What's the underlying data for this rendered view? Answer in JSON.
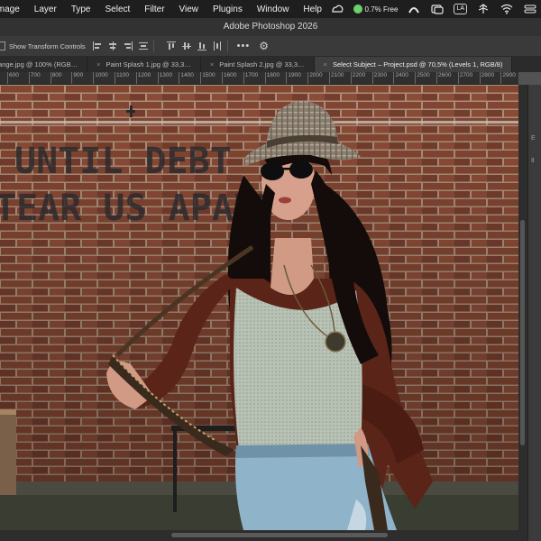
{
  "menubar": {
    "items": [
      "Image",
      "Layer",
      "Type",
      "Select",
      "Filter",
      "View",
      "Plugins",
      "Window",
      "Help"
    ],
    "memory_status": "0.7% Free",
    "keyboard_badge": "LA",
    "tray_icons": [
      "creative-cloud-icon",
      "memory-icon",
      "arc-icon",
      "window-icon",
      "keyboard-icon",
      "network-icon",
      "wifi-icon",
      "control-center-icon"
    ]
  },
  "window": {
    "title": "Adobe Photoshop 2026"
  },
  "options": {
    "transform_label": "Show Transform Controls",
    "more_label": "•••"
  },
  "tabs": [
    {
      "label": "ange.jpg @ 100% (RGB…",
      "active": false
    },
    {
      "label": "Paint Splash 1.jpg @ 33,3…",
      "active": false
    },
    {
      "label": "Paint Splash 2.jpg @ 33,3…",
      "active": false
    },
    {
      "label": "Select Subject – Project.psd @ 70,5% (Levels 1, RGB/8)",
      "active": true
    }
  ],
  "ruler": {
    "ticks": [
      "600",
      "700",
      "800",
      "900",
      "1000",
      "1100",
      "1200",
      "1300",
      "1400",
      "1500",
      "1600",
      "1700",
      "1800",
      "1900",
      "2000",
      "2100",
      "2200",
      "2300",
      "2400",
      "2500",
      "2600",
      "2700",
      "2800",
      "2900"
    ]
  },
  "canvas": {
    "wall_text_line1": "UNTIL DEBT",
    "wall_text_line2": "TEAR US APART"
  },
  "right_panel": {
    "glyphs": [
      "E",
      "Ⅱ"
    ]
  },
  "colors": {
    "menubar_bg": "#1e1e1e",
    "panel_bg": "#3a3a3a",
    "brick": "#8a4a34",
    "mortar": "#b79a86",
    "cardigan": "#5a2418",
    "jeans": "#8fb3c8",
    "top": "#b6c1b3"
  }
}
